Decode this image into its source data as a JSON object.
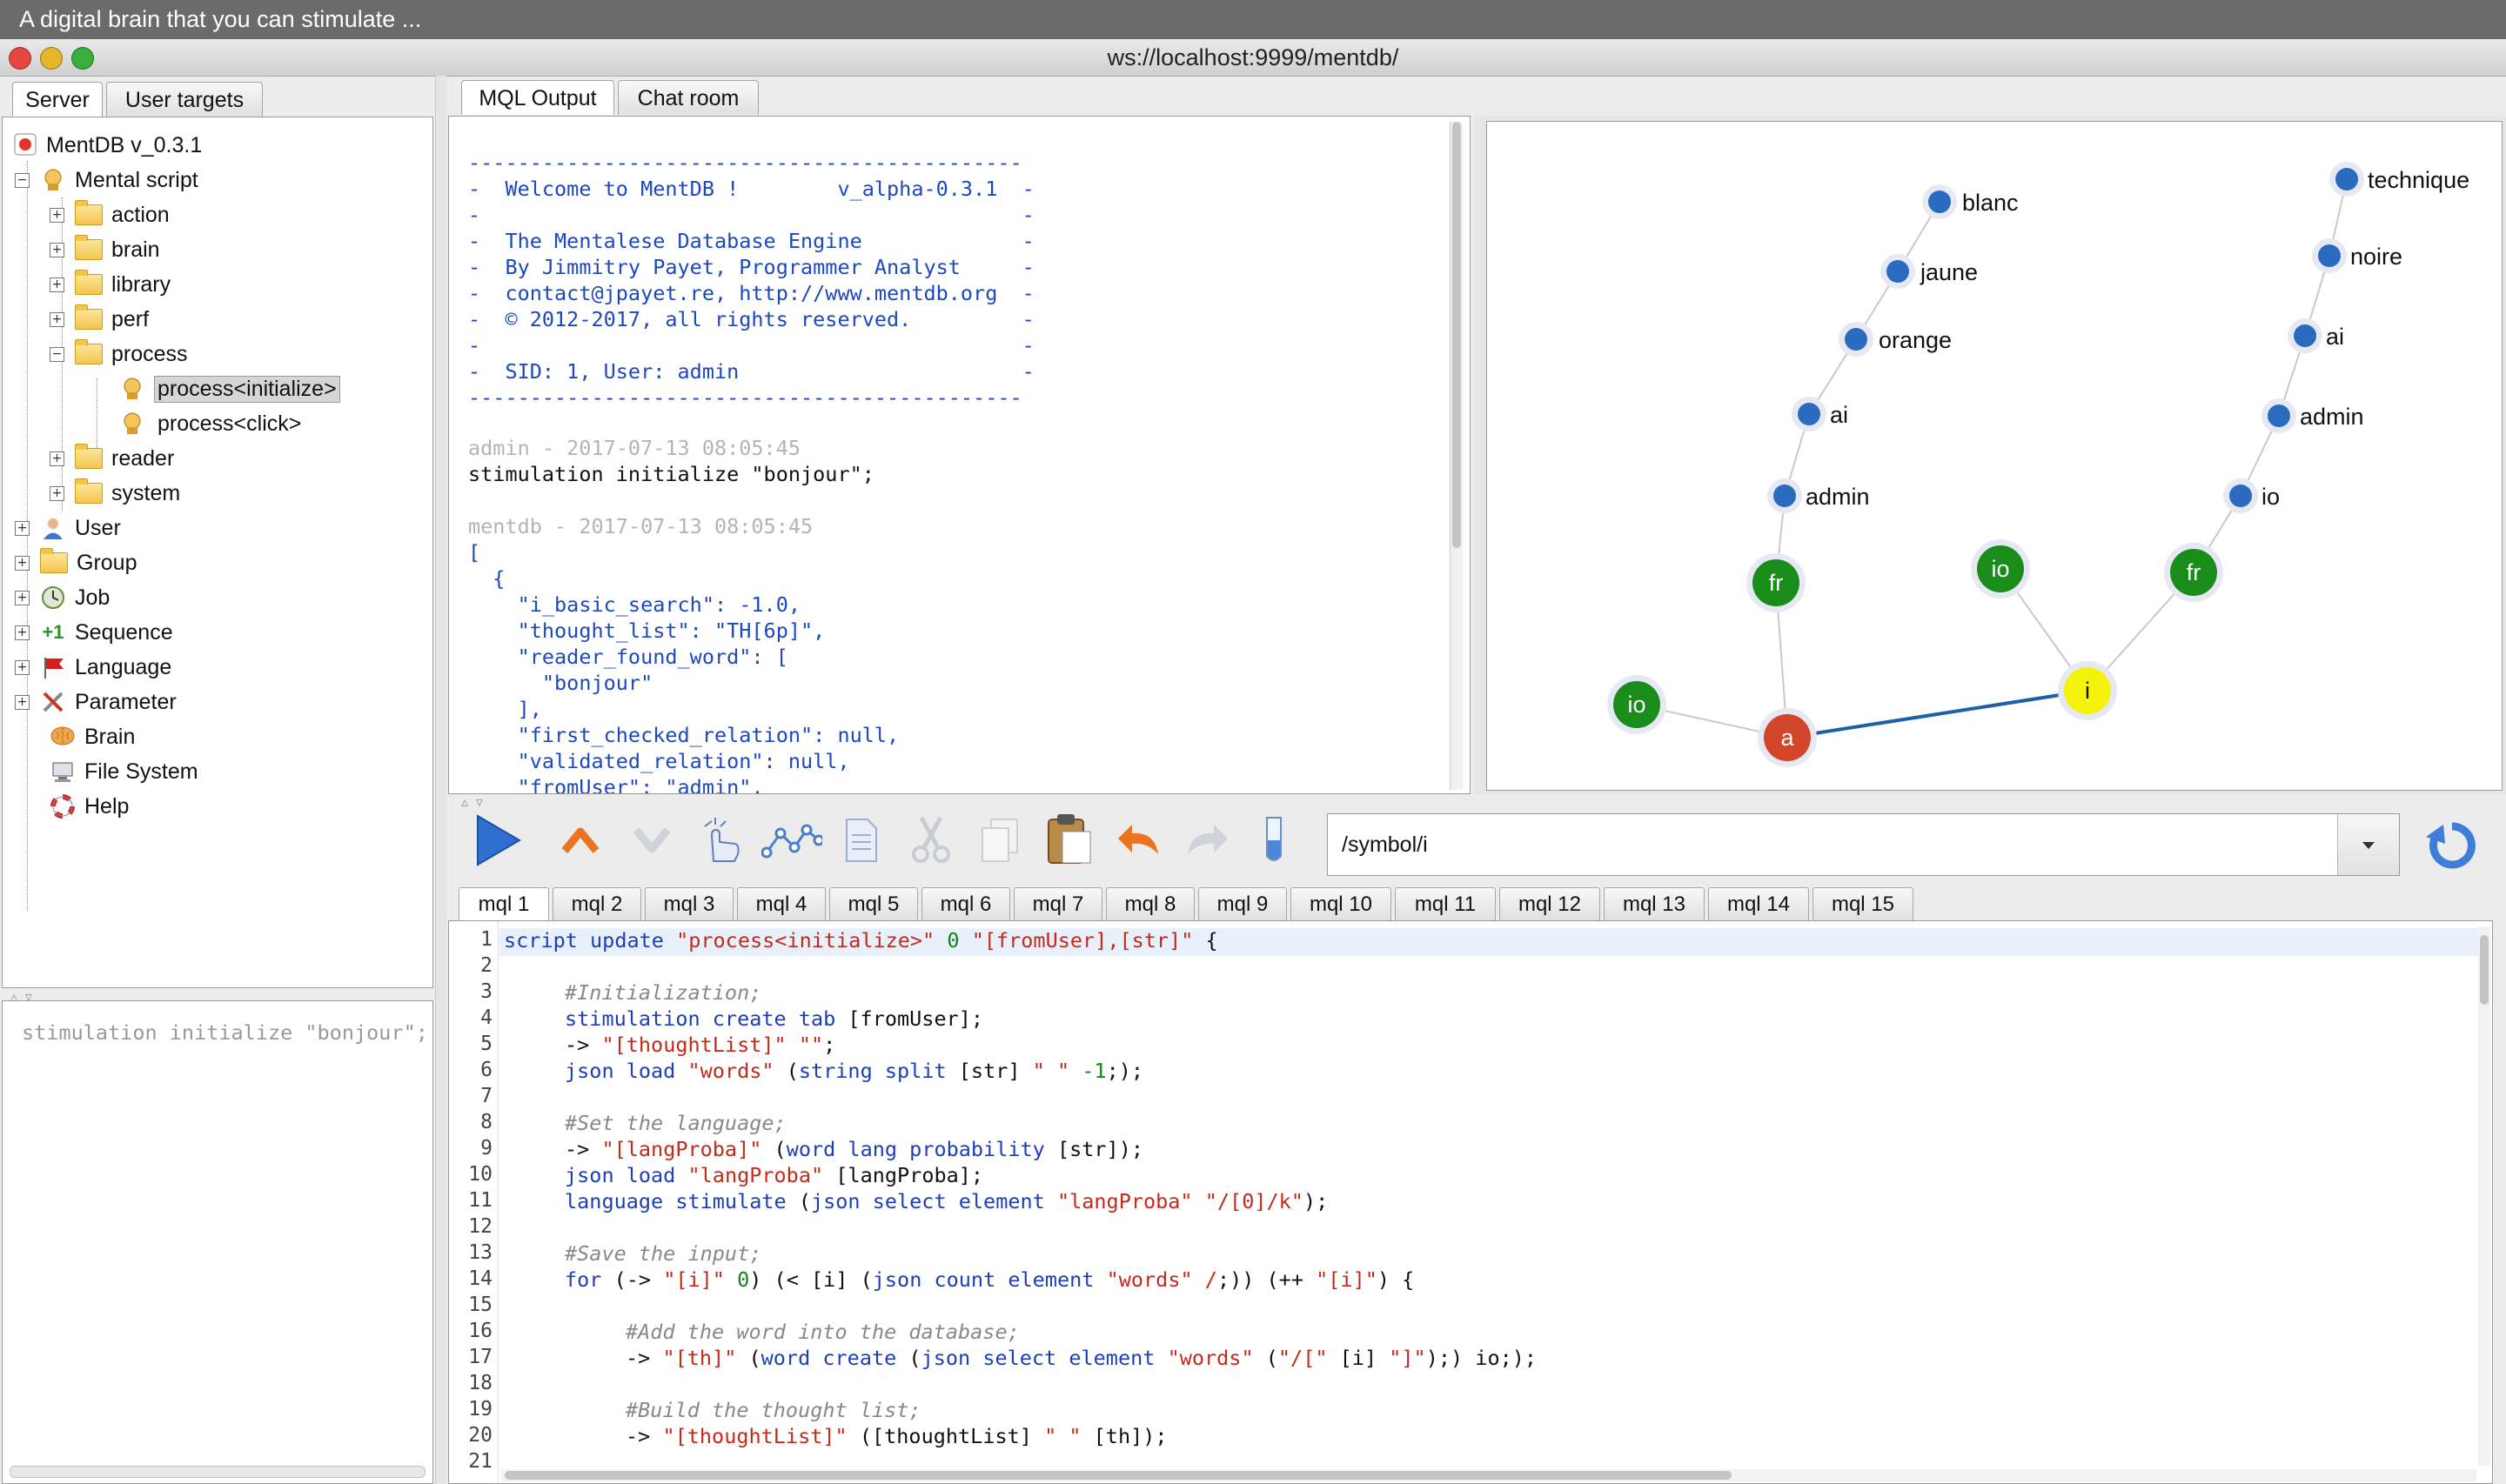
{
  "app": {
    "banner": "A digital brain that you can stimulate ...",
    "window_title": "ws://localhost:9999/mentdb/"
  },
  "left_tabs": [
    "Server",
    "User targets"
  ],
  "tree": {
    "root": "MentDB v_0.3.1",
    "mental_script": "Mental script",
    "folders": [
      "action",
      "brain",
      "library",
      "perf",
      "process"
    ],
    "process_children": [
      "process<initialize>",
      "process<click>"
    ],
    "more_folders": [
      "reader",
      "system"
    ],
    "top_items": [
      "User",
      "Group",
      "Job",
      "Sequence",
      "Language",
      "Parameter",
      "Brain",
      "File System",
      "Help"
    ],
    "sequence_badge": "+1"
  },
  "history": {
    "text": "stimulation initialize \"bonjour\";"
  },
  "right_tabs": [
    "MQL Output",
    "Chat room"
  ],
  "output": {
    "banner_lines": [
      "---------------------------------------------",
      "-  Welcome to MentDB !        v_alpha-0.3.1  -",
      "-                                            -",
      "-  The Mentalese Database Engine             -",
      "-  By Jimmitry Payet, Programmer Analyst     -",
      "-  contact@jpayet.re, http://www.mentdb.org  -",
      "-  © 2012-2017, all rights reserved.         -",
      "-                                            -",
      "-  SID: 1, User: admin                       -",
      "---------------------------------------------"
    ],
    "admin_stamp": "admin - 2017-07-13 08:05:45",
    "command": "stimulation initialize \"bonjour\";",
    "mentdb_stamp": "mentdb - 2017-07-13 08:05:45",
    "json_lines": [
      "[",
      "  {",
      "    \"i_basic_search\": -1.0,",
      "    \"thought_list\": \"TH[6p]\",",
      "    \"reader_found_word\": [",
      "      \"bonjour\"",
      "    ],",
      "    \"first_checked_relation\": null,",
      "    \"validated_relation\": null,",
      "    \"fromUser\": \"admin\","
    ]
  },
  "graph": {
    "nodes": [
      {
        "label": "blanc",
        "kind": "word"
      },
      {
        "label": "jaune",
        "kind": "word"
      },
      {
        "label": "orange",
        "kind": "word"
      },
      {
        "label": "ai",
        "kind": "word"
      },
      {
        "label": "admin",
        "kind": "word"
      },
      {
        "label": "fr",
        "kind": "green"
      },
      {
        "label": "io",
        "kind": "green"
      },
      {
        "label": "a",
        "kind": "red"
      },
      {
        "label": "io",
        "kind": "green"
      },
      {
        "label": "i",
        "kind": "yellow"
      },
      {
        "label": "fr",
        "kind": "green"
      },
      {
        "label": "io",
        "kind": "word"
      },
      {
        "label": "admin",
        "kind": "word"
      },
      {
        "label": "ai",
        "kind": "word"
      },
      {
        "label": "noire",
        "kind": "word"
      },
      {
        "label": "technique",
        "kind": "word"
      }
    ],
    "colors": {
      "word": "#2a6bbf",
      "green": "#1a8c1a",
      "red": "#d2452b",
      "yellow": "#f4f20a",
      "edge": "#c9c9c9",
      "link": "#1f5fa8"
    }
  },
  "toolbar": {
    "icons": [
      "run-icon",
      "up-icon",
      "down-icon",
      "hand-icon",
      "graph-icon",
      "document-icon",
      "cut-icon",
      "copy-icon",
      "paste-icon",
      "undo-icon",
      "redo-icon",
      "test-tube-icon"
    ],
    "path_value": "/symbol/i",
    "refresh": "refresh-icon"
  },
  "mql_tabs": [
    "mql 1",
    "mql 2",
    "mql 3",
    "mql 4",
    "mql 5",
    "mql 6",
    "mql 7",
    "mql 8",
    "mql 9",
    "mql 10",
    "mql 11",
    "mql 12",
    "mql 13",
    "mql 14",
    "mql 15"
  ],
  "editor": {
    "line_numbers": [
      "1",
      "2",
      "3",
      "4",
      "5",
      "6",
      "7",
      "8",
      "9",
      "10",
      "11",
      "12",
      "13",
      "14",
      "15",
      "16",
      "17",
      "18",
      "19",
      "20",
      "21"
    ]
  }
}
